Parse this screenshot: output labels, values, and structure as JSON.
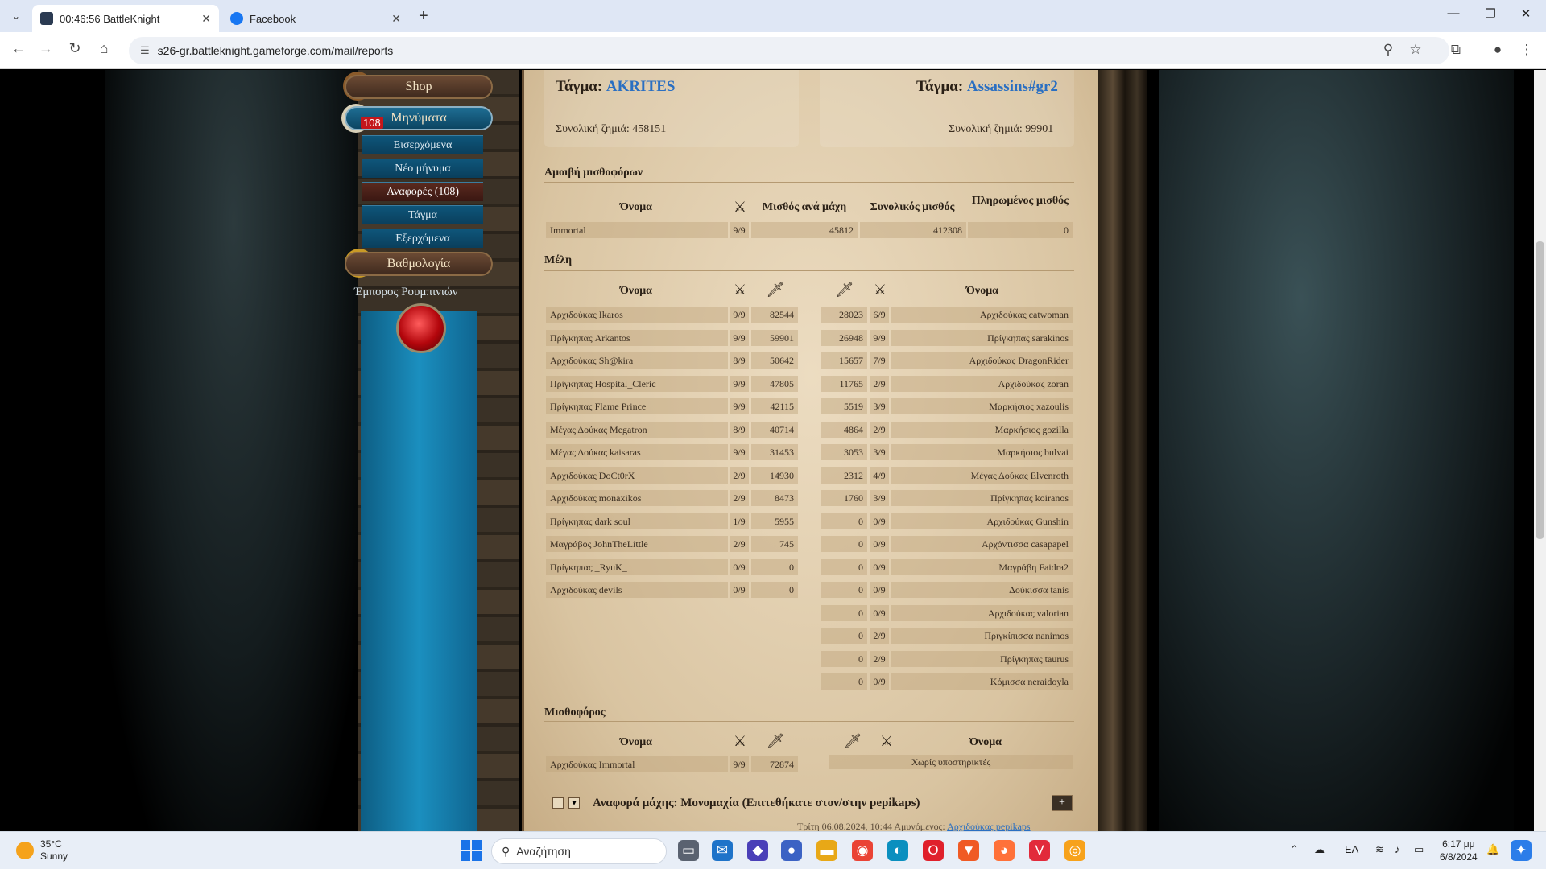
{
  "browser": {
    "tabs": [
      {
        "title": "00:46:56 BattleKnight",
        "active": true
      },
      {
        "title": "Facebook",
        "active": false
      }
    ],
    "url": "s26-gr.battleknight.gameforge.com/mail/reports"
  },
  "menu": {
    "shop": "Shop",
    "messages": "Μηνύματα",
    "badge": "108",
    "sub": [
      "Εισερχόμενα",
      "Νέο μήνυμα",
      "Αναφορές (108)",
      "Τάγμα",
      "Εξερχόμενα"
    ],
    "ranking": "Βαθμολογία",
    "merchant": "Έμπορος Ρουμπινιών"
  },
  "clans": {
    "left": {
      "label": "Τάγμα:",
      "name": "AKRITES",
      "loss_label": "Συνολική ζημιά:",
      "loss": "458151"
    },
    "right": {
      "label": "Τάγμα:",
      "name": "Assassins#gr2",
      "loss_label": "Συνολική ζημιά:",
      "loss": "99901"
    }
  },
  "payment": {
    "title": "Αμοιβή μισθοφόρων",
    "headers": {
      "name": "Όνομα",
      "per_battle": "Μισθός ανά μάχη",
      "total": "Συνολικός μισθός",
      "paid": "Πληρωμένος μισθός"
    },
    "row": {
      "name": "Immortal",
      "fights": "9/9",
      "per_battle": "45812",
      "total": "412308",
      "paid": "0"
    }
  },
  "members": {
    "title": "Μέλη",
    "header_name": "Όνομα",
    "left": [
      {
        "name": "Αρχιδούκας Ikaros",
        "f": "9/9",
        "d": "82544"
      },
      {
        "name": "Πρίγκηπας Arkantos",
        "f": "9/9",
        "d": "59901"
      },
      {
        "name": "Αρχιδούκας Sh@kira",
        "f": "8/9",
        "d": "50642"
      },
      {
        "name": "Πρίγκηπας Hospital_Cleric",
        "f": "9/9",
        "d": "47805"
      },
      {
        "name": "Πρίγκηπας Flame Prince",
        "f": "9/9",
        "d": "42115"
      },
      {
        "name": "Μέγας Δούκας Megatron",
        "f": "8/9",
        "d": "40714"
      },
      {
        "name": "Μέγας Δούκας kaisaras",
        "f": "9/9",
        "d": "31453"
      },
      {
        "name": "Αρχιδούκας DoCt0rX",
        "f": "2/9",
        "d": "14930"
      },
      {
        "name": "Αρχιδούκας monaxikos",
        "f": "2/9",
        "d": "8473"
      },
      {
        "name": "Πρίγκηπας dark soul",
        "f": "1/9",
        "d": "5955"
      },
      {
        "name": "Μαγράβος JohnTheLittle",
        "f": "2/9",
        "d": "745"
      },
      {
        "name": "Πρίγκηπας _RyuK_",
        "f": "0/9",
        "d": "0"
      },
      {
        "name": "Αρχιδούκας devils",
        "f": "0/9",
        "d": "0"
      }
    ],
    "right": [
      {
        "d": "28023",
        "f": "6/9",
        "name": "Αρχιδούκας catwoman"
      },
      {
        "d": "26948",
        "f": "9/9",
        "name": "Πρίγκηπας sarakinos"
      },
      {
        "d": "15657",
        "f": "7/9",
        "name": "Αρχιδούκας DragonRider"
      },
      {
        "d": "11765",
        "f": "2/9",
        "name": "Αρχιδούκας zoran"
      },
      {
        "d": "5519",
        "f": "3/9",
        "name": "Μαρκήσιος xazoulis"
      },
      {
        "d": "4864",
        "f": "2/9",
        "name": "Μαρκήσιος gozilla"
      },
      {
        "d": "3053",
        "f": "3/9",
        "name": "Μαρκήσιος bulvai"
      },
      {
        "d": "2312",
        "f": "4/9",
        "name": "Μέγας Δούκας Elvenroth"
      },
      {
        "d": "1760",
        "f": "3/9",
        "name": "Πρίγκηπας koiranos"
      },
      {
        "d": "0",
        "f": "0/9",
        "name": "Αρχιδούκας Gunshin"
      },
      {
        "d": "0",
        "f": "0/9",
        "name": "Αρχόντισσα casapapel"
      },
      {
        "d": "0",
        "f": "0/9",
        "name": "Μαγράβη Faidra2"
      },
      {
        "d": "0",
        "f": "0/9",
        "name": "Δούκισσα tanis"
      },
      {
        "d": "0",
        "f": "0/9",
        "name": "Αρχιδούκας valorian"
      },
      {
        "d": "0",
        "f": "2/9",
        "name": "Πριγκίπισσα nanimos"
      },
      {
        "d": "0",
        "f": "2/9",
        "name": "Πρίγκηπας taurus"
      },
      {
        "d": "0",
        "f": "0/9",
        "name": "Κόμισσα neraidoyla"
      }
    ]
  },
  "mercenaries": {
    "title": "Μισθοφόρος",
    "header_name": "Όνομα",
    "left": {
      "name": "Αρχιδούκας Immortal",
      "f": "9/9",
      "d": "72874"
    },
    "right_empty": "Χωρίς υποστηρικτές"
  },
  "report": {
    "title": "Αναφορά μάχης: Μονομαχία (Επιτεθήκατε στον/στην pepikaps)",
    "date": "Τρίτη 06.08.2024, 10:44 Αμυνόμενος:",
    "defender": "Αρχιδούκας pepikaps"
  },
  "taskbar": {
    "temp": "35°C",
    "weather": "Sunny",
    "search": "Αναζήτηση",
    "lang": "ΕΛ",
    "time": "6:17 μμ",
    "date": "6/8/2024"
  }
}
